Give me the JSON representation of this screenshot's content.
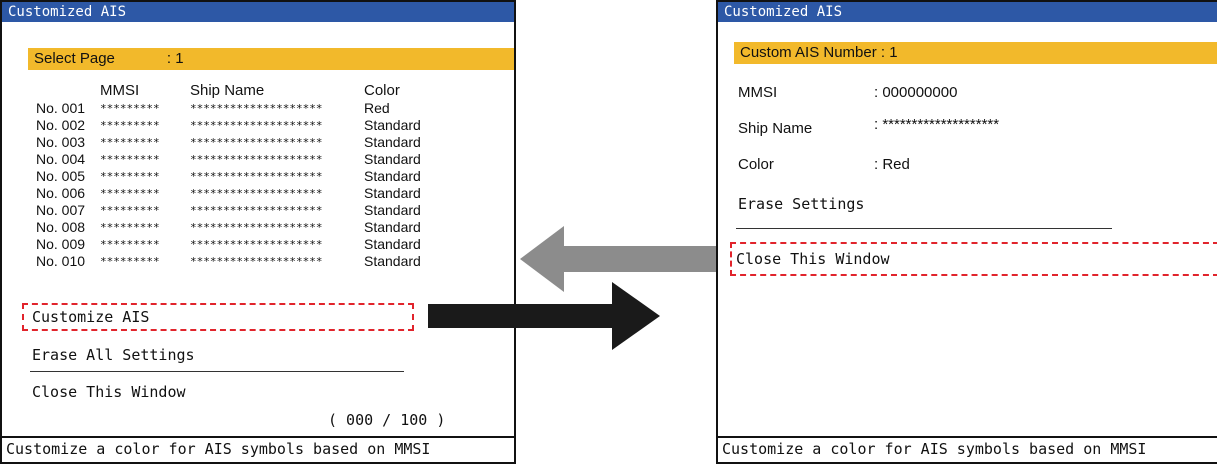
{
  "left": {
    "title": "Customized AIS",
    "select_page_label": "Select Page",
    "select_page_value": ": 1",
    "headers": {
      "mmsi": "MMSI",
      "ship_name": "Ship Name",
      "color": "Color"
    },
    "rows": [
      {
        "no": "No. 001",
        "mmsi": "*********",
        "ship": "********************",
        "color": "Red"
      },
      {
        "no": "No. 002",
        "mmsi": "*********",
        "ship": "********************",
        "color": "Standard"
      },
      {
        "no": "No. 003",
        "mmsi": "*********",
        "ship": "********************",
        "color": "Standard"
      },
      {
        "no": "No. 004",
        "mmsi": "*********",
        "ship": "********************",
        "color": "Standard"
      },
      {
        "no": "No. 005",
        "mmsi": "*********",
        "ship": "********************",
        "color": "Standard"
      },
      {
        "no": "No. 006",
        "mmsi": "*********",
        "ship": "********************",
        "color": "Standard"
      },
      {
        "no": "No. 007",
        "mmsi": "*********",
        "ship": "********************",
        "color": "Standard"
      },
      {
        "no": "No. 008",
        "mmsi": "*********",
        "ship": "********************",
        "color": "Standard"
      },
      {
        "no": "No. 009",
        "mmsi": "*********",
        "ship": "********************",
        "color": "Standard"
      },
      {
        "no": "No. 010",
        "mmsi": "*********",
        "ship": "********************",
        "color": "Standard"
      }
    ],
    "customize_label": "Customize AIS",
    "erase_all_label": "Erase All Settings",
    "close_label": "Close This Window",
    "pager": "( 000 / 100 )",
    "status": "Customize a color for AIS symbols based on MMSI"
  },
  "right": {
    "title": "Customized AIS",
    "custom_number": "Custom AIS Number : 1",
    "mmsi_label": "MMSI",
    "mmsi_value": ": 000000000",
    "ship_label": "Ship Name",
    "ship_value": ": ********************",
    "color_label": "Color",
    "color_value": ": Red",
    "erase_label": "Erase Settings",
    "close_label": "Close This Window",
    "status": "Customize a color for AIS symbols based on MMSI"
  },
  "colors": {
    "titlebar": "#2d58a6",
    "highlight_bar": "#f2b92b",
    "focus_dash": "#e1242c",
    "arrow_back": "#8c8c8c",
    "arrow_forward": "#1a1a1a"
  },
  "icons": {
    "back": "left-arrow-icon",
    "forward": "right-arrow-icon"
  }
}
